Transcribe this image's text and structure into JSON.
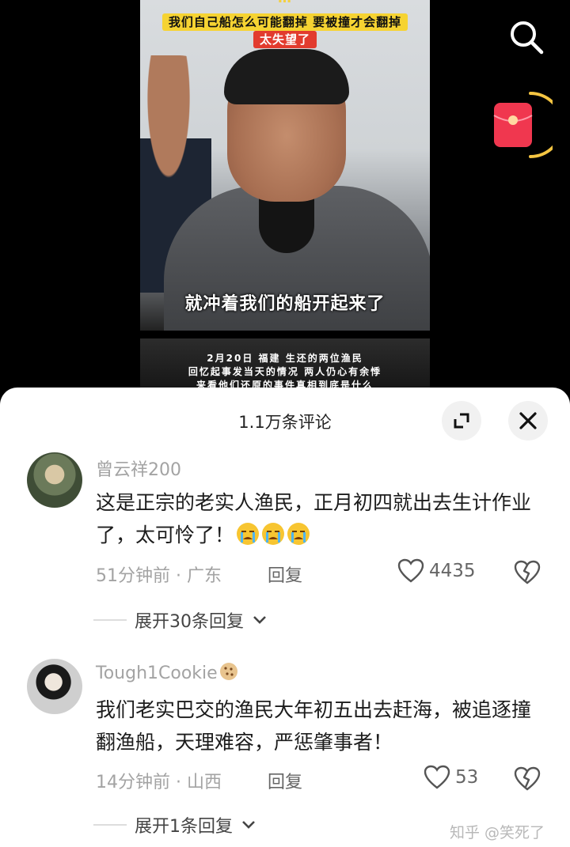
{
  "video": {
    "caption_top": "…",
    "caption_line2": "我们自己船怎么可能翻掉 要被撞才会翻掉",
    "caption_line3": "太失望了",
    "subtitle": "就冲着我们的船开起来了",
    "info_line1": "2月20日 福建 生还的两位渔民",
    "info_line2": "回忆起事发当天的情况 两人仍心有余悸",
    "info_line3": "来看他们还原的事件真相到底是什么"
  },
  "icons": {
    "search": "search-icon",
    "red_packet": "red-packet-icon",
    "expand": "expand-icon",
    "close": "close-icon",
    "heart": "heart-icon",
    "dislike": "broken-heart-icon",
    "chevron": "chevron-down-icon"
  },
  "colors": {
    "accent_red": "#f0374f",
    "ring_yellow": "#f5c542"
  },
  "sheet": {
    "title": "1.1万条评论"
  },
  "comments": [
    {
      "username": "曾云祥200",
      "text": "这是正宗的老实人渔民，正月初四就出去生计作业了，太可怜了！",
      "time_location": "51分钟前 · 广东",
      "reply_label": "回复",
      "likes": "4435",
      "expand_replies": "展开30条回复"
    },
    {
      "username": "Tough1Cookie",
      "text": "我们老实巴交的渔民大年初五出去赶海，被追逐撞翻渔船，天理难容，严惩肇事者！",
      "time_location": "14分钟前 · 山西",
      "reply_label": "回复",
      "likes": "53",
      "expand_replies": "展开1条回复"
    }
  ],
  "watermark": "知乎 @笑死了"
}
